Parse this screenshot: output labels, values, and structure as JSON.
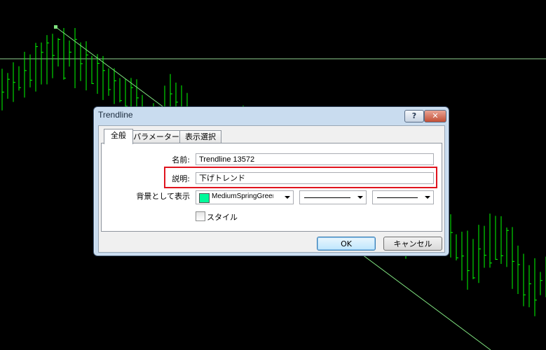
{
  "chart": {
    "background": "#000000",
    "bar_color": "#00ff00",
    "line_color": "#90ee90"
  },
  "dialog": {
    "title": "Trendline",
    "help_glyph": "?",
    "close_glyph": "✕",
    "tabs": [
      {
        "label": "全般",
        "active": true
      },
      {
        "label": "パラメーター",
        "active": false
      },
      {
        "label": "表示選択",
        "active": false
      }
    ],
    "name_label": "名前:",
    "name_value": "Trendline 13572",
    "description_label": "説明:",
    "description_value": "下げトレンド",
    "background_label": "背景として表示",
    "color_value": "MediumSpringGreen",
    "color_hex": "#00fa9a",
    "style_label": "スタイル",
    "ok_label": "OK",
    "cancel_label": "キャンセル",
    "highlight_color": "#e0141e"
  }
}
